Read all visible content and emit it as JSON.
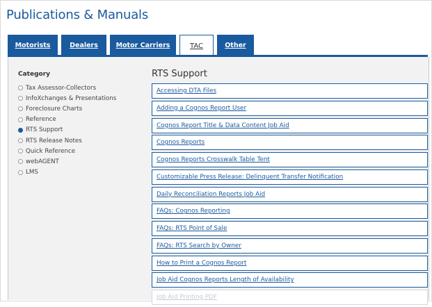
{
  "page_title": "Publications & Manuals",
  "tabs": [
    {
      "label": "Motorists"
    },
    {
      "label": "Dealers"
    },
    {
      "label": "Motor Carriers"
    },
    {
      "label": "TAC",
      "active": true
    },
    {
      "label": "Other"
    }
  ],
  "category": {
    "title": "Category",
    "items": [
      {
        "label": "Tax Assessor-Collectors",
        "selected": false
      },
      {
        "label": "InfoXchanges & Presentations",
        "selected": false
      },
      {
        "label": "Foreclosure Charts",
        "selected": false
      },
      {
        "label": "Reference",
        "selected": false
      },
      {
        "label": "RTS Support",
        "selected": true
      },
      {
        "label": "RTS Release Notes",
        "selected": false
      },
      {
        "label": "Quick Reference",
        "selected": false
      },
      {
        "label": "webAGENT",
        "selected": false
      },
      {
        "label": "LMS",
        "selected": false
      }
    ]
  },
  "section_title": "RTS Support",
  "links": [
    "Accessing DTA Files",
    "Adding a Cognos Report User",
    "Cognos Report Title & Data Content Job Aid",
    "Cognos Reports",
    "Cognos Reports Crosswalk Table Tent",
    "Customizable Press Release: Delinquent Transfer Notification",
    "Daily Reconciliation Reports Job Aid",
    "FAQs: Cognos Reporting",
    "FAQs: RTS Point of Sale",
    "FAQs: RTS Search by Owner",
    "How to Print a Cognos Report",
    "Job Aid Cognos Reports Length of Availability",
    "Job Aid Printing PDF"
  ],
  "colors": {
    "accent": "#1a5a9e",
    "panel_bg": "#f2f2f2"
  }
}
